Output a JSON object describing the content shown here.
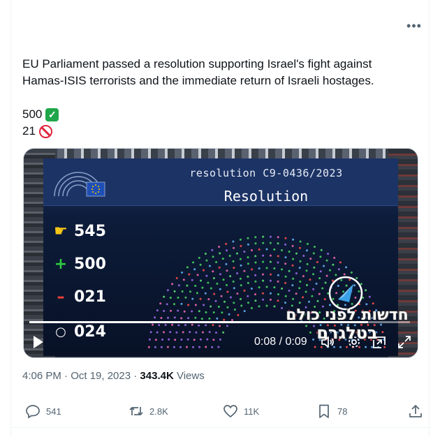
{
  "post": {
    "text": "EU Parliament passed a resolution supporting Israel's fight against Hamas-ISIS terrorists and the immediate return of Israeli hostages.",
    "count_for": "500",
    "count_against": "21",
    "more_label": "•••"
  },
  "video": {
    "resolution_code": "resolution C9-0436/2023",
    "resolution_title": "Resolution",
    "votes": [
      {
        "label": "545",
        "icon": "hand-icon",
        "color": "#f5c518"
      },
      {
        "label": "500",
        "icon": "plus-icon",
        "color": "#2ecc40"
      },
      {
        "label": "021",
        "icon": "minus-icon",
        "color": "#ff4136"
      },
      {
        "label": "024",
        "icon": "circle-icon",
        "color": "#ffffff"
      }
    ],
    "watermark_line1": "חדשות לפני כולם",
    "watermark_line2": "בטלגרם",
    "time": "0:08 / 0:09",
    "progress": 0.89
  },
  "meta": {
    "time": "4:06 PM · Oct 19, 2023 · ",
    "views_count": "343.4K",
    "views_label": " Views"
  },
  "actions": {
    "replies": "541",
    "reposts": "2.8K",
    "likes": "11K",
    "bookmarks": "78"
  },
  "colors": {
    "text": "#0f1419",
    "secondary": "#536471",
    "border": "#eff3f4"
  }
}
